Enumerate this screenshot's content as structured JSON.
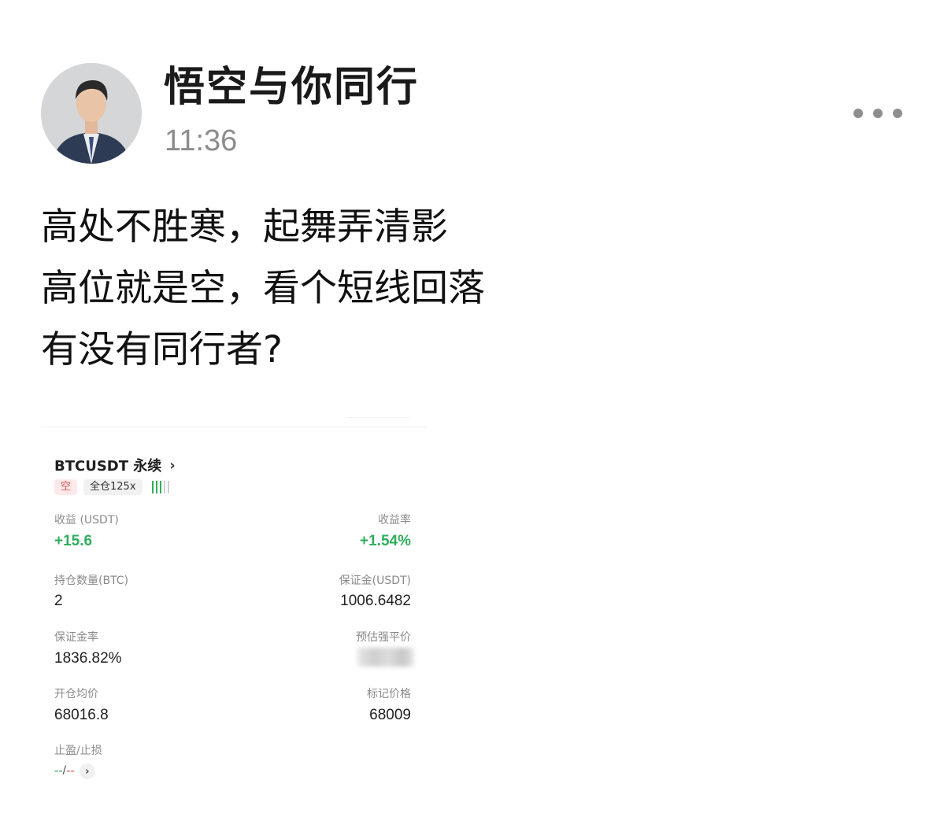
{
  "post": {
    "author": "悟空与你同行",
    "time": "11:36",
    "lines": [
      "高处不胜寒，起舞弄清影",
      "高位就是空，看个短线回落",
      "有没有同行者?"
    ],
    "more_icon": "more-horizontal-icon"
  },
  "position_card": {
    "symbol": "BTCUSDT 永续",
    "side_tag": "空",
    "mode_tag": "全仓125x",
    "pnl_label": "收益 (USDT)",
    "pnl_value": "+15.6",
    "roe_label": "收益率",
    "roe_value": "+1.54%",
    "size_label": "持仓数量(BTC)",
    "size_value": "2",
    "margin_label": "保证金(USDT)",
    "margin_value": "1006.6482",
    "margin_ratio_label": "保证金率",
    "margin_ratio_value": "1836.82%",
    "liq_label": "预估强平价",
    "entry_label": "开仓均价",
    "entry_value": "68016.8",
    "mark_label": "标记价格",
    "mark_value": "68009",
    "tpsl_label": "止盈/止损",
    "tpsl_tp": "--",
    "tpsl_sep": "/",
    "tpsl_sl": "--",
    "colors": {
      "positive": "#2fae5b",
      "short": "#e0544f"
    }
  }
}
